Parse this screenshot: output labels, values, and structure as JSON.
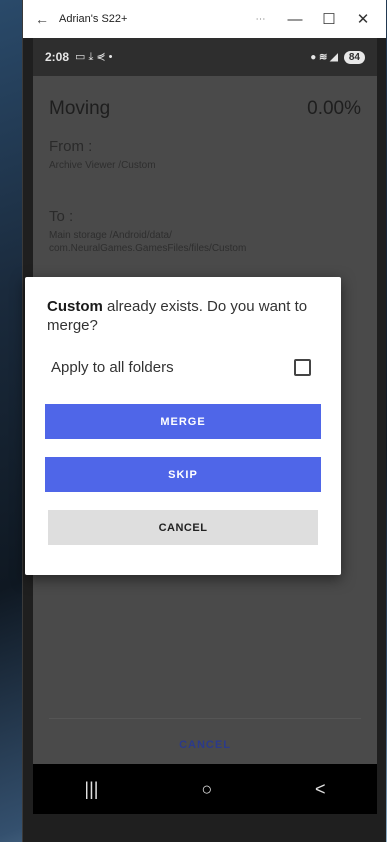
{
  "window": {
    "title": "Adrian's S22+",
    "back_icon": "←",
    "more_label": "⋯",
    "minimize_icon": "—",
    "maximize_icon": "☐",
    "close_icon": "✕"
  },
  "status_bar": {
    "time": "2:08",
    "left_icons": "▭ ⤓ ⋞ •",
    "right_icons": "● ≋ ◢",
    "battery": "84"
  },
  "screen": {
    "operation": "Moving",
    "percent": "0.00%",
    "from_label": "From :",
    "from_path": "Archive Viewer /Custom",
    "to_label": "To :",
    "to_path_line1": "Main storage /Android/data/",
    "to_path_line2": "com.NeuralGames.GamesFiles/files/Custom",
    "bottom_cancel": "CANCEL"
  },
  "dialog": {
    "folder_name": "Custom",
    "message_rest": " already exists. Do you want to merge?",
    "apply_label": "Apply to all folders",
    "apply_checked": false,
    "merge_label": "MERGE",
    "skip_label": "SKIP",
    "cancel_label": "CANCEL"
  },
  "nav_bar": {
    "recents": "|||",
    "home": "○",
    "back": "<"
  },
  "colors": {
    "accent": "#4f66e8",
    "dialog_bg": "#ffffff",
    "scrim": "#4a4a4a"
  }
}
